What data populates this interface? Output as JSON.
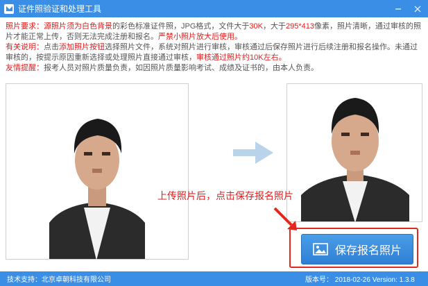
{
  "window": {
    "title": "证件照验证和处理工具",
    "icon": "app-logo-icon",
    "minimize_icon": "minimize-icon",
    "close_icon": "close-icon"
  },
  "info": {
    "req_label": "照片要求：",
    "req_1": "源照片须为",
    "req_white_bg": "白色背景",
    "req_2": "的彩色标准证件照，JPG格式，文件大于",
    "req_30k": "30K",
    "req_3": "，大于",
    "req_size": "295*413",
    "req_4": "像素，照片清晰，通过审核的照片才能正常上传，否则无法完成注册和报名。",
    "req_5": "严禁小照片放大后使用。",
    "note_label": "有关说明：",
    "note_1": "点击",
    "note_add_btn": "添加照片按钮",
    "note_2": "选择照片文件，系统对照片进行审核，审核通过后保存照片进行后续注册和报名操作。未通过审核的，按提示原因重新选择或处理照片直接通过审核，",
    "note_3": "审核通过照片约10K左右。",
    "tip_label": "友情提醒：",
    "tip_text": "报考人员对照片质量负责，如因照片质量影响考试、成绩及证书的，由本人负责。"
  },
  "annotation": "上传照片后，点击保存报名照片",
  "save_button": {
    "label": "保存报名照片",
    "icon": "image-icon"
  },
  "statusbar": {
    "support": "技术支持：北京卓朝科技有限公司",
    "version": "版本号：     2018-02-26 Version: 1.3.8"
  },
  "colors": {
    "titlebar": "#3a8ee6",
    "accent_red": "#e02020",
    "button": "#3a8ee6"
  }
}
